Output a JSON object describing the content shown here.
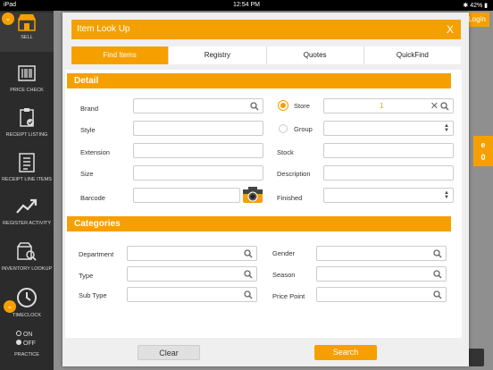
{
  "statusbar": {
    "device": "iPad",
    "time": "12:54 PM",
    "battery": "42%"
  },
  "sidebar": {
    "items": [
      {
        "label": "SELL"
      },
      {
        "label": "PRICE CHECK"
      },
      {
        "label": "RECEIPT LISTING"
      },
      {
        "label": "RECEIPT LINE ITEMS"
      },
      {
        "label": "REGISTER ACTIVITY"
      },
      {
        "label": "INVENTORY LOOKUP"
      },
      {
        "label": "TIMECLOCK"
      },
      {
        "label": "PRACTICE"
      }
    ],
    "practice_on": "ON",
    "practice_off": "OFF"
  },
  "background": {
    "login": "Login",
    "orange_text": "e\n0"
  },
  "modal": {
    "title": "Item Look Up",
    "close": "X",
    "tabs": [
      {
        "label": "Find Items",
        "active": true
      },
      {
        "label": "Registry",
        "active": false
      },
      {
        "label": "Quotes",
        "active": false
      },
      {
        "label": "QuickFind",
        "active": false
      }
    ],
    "detail": {
      "header": "Detail",
      "brand": "Brand",
      "style": "Style",
      "extension": "Extension",
      "size": "Size",
      "barcode": "Barcode",
      "store": "Store",
      "store_value": "1",
      "group": "Group",
      "stock": "Stock",
      "description": "Description",
      "finished": "Finished"
    },
    "categories": {
      "header": "Categories",
      "department": "Department",
      "type": "Type",
      "subtype": "Sub Type",
      "gender": "Gender",
      "season": "Season",
      "pricepoint": "Price Point"
    },
    "buttons": {
      "clear": "Clear",
      "search": "Search"
    }
  },
  "colors": {
    "accent": "#f5a000",
    "sidebar_bg": "#2b2b2b"
  }
}
